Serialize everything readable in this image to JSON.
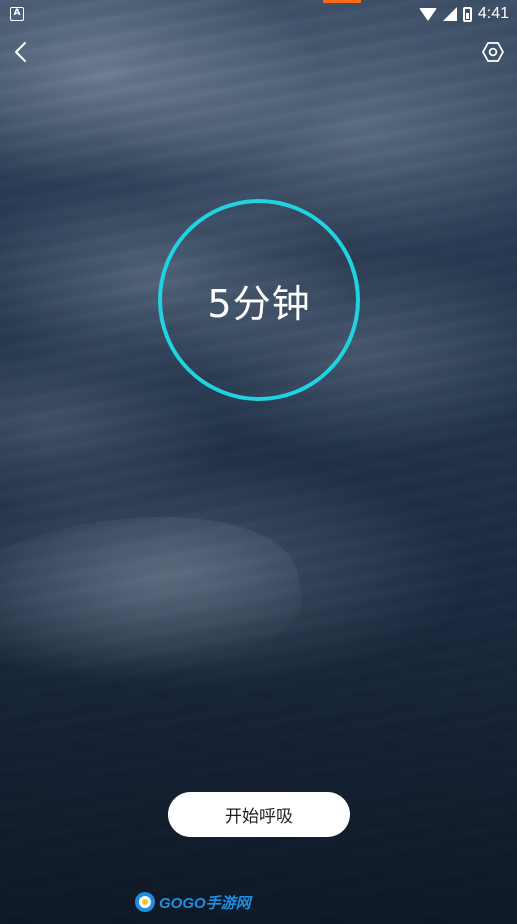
{
  "status_bar": {
    "notification_icon": "a-letter-icon",
    "time": "4:41",
    "icons": [
      "wifi-icon",
      "signal-icon",
      "battery-icon"
    ]
  },
  "nav": {
    "back_icon": "chevron-left-icon",
    "settings_icon": "hexagon-gear-icon"
  },
  "timer": {
    "label": "5分钟",
    "ring_color": "#20d3e0"
  },
  "actions": {
    "start_label": "开始呼吸"
  },
  "watermark": {
    "text": "GOGO手游网"
  },
  "colors": {
    "accent": "#20d3e0",
    "status_indicator": "#ff6a1a",
    "button_bg": "#ffffff"
  }
}
